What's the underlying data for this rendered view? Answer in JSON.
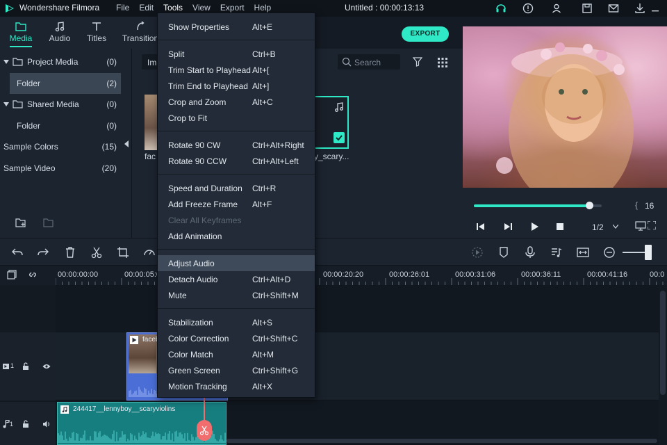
{
  "app": {
    "name": "Wondershare Filmora",
    "menus": [
      "File",
      "Edit",
      "Tools",
      "View",
      "Export",
      "Help"
    ],
    "active_menu": "Tools",
    "document_title": "Untitled : 00:00:13:13"
  },
  "media_tabs": [
    {
      "label": "Media",
      "icon": "media-folder-icon",
      "active": true
    },
    {
      "label": "Audio",
      "icon": "music-note-icon",
      "active": false
    },
    {
      "label": "Titles",
      "icon": "text-t-icon",
      "active": false
    },
    {
      "label": "Transition",
      "icon": "transition-icon",
      "active": false
    }
  ],
  "export_label": "EXPORT",
  "tree": [
    {
      "label": "Project Media",
      "count": "(0)",
      "folder": true
    },
    {
      "label": "Folder",
      "count": "(2)",
      "selected": true
    },
    {
      "label": "Shared Media",
      "count": "(0)",
      "folder": true
    },
    {
      "label": "Folder",
      "count": "(0)"
    },
    {
      "label": "Sample Colors",
      "count": "(15)"
    },
    {
      "label": "Sample Video",
      "count": "(20)"
    }
  ],
  "browser": {
    "import_label": "Im",
    "search_placeholder": "Search",
    "clip1_name": "fac",
    "clip2_name": "y_scary..."
  },
  "preview": {
    "progress": 0.9,
    "frame_value": "16",
    "quality": "1/2"
  },
  "ruler": [
    "00:00:00:00",
    "00:00:05:0",
    "00:00:20:20",
    "00:00:26:01",
    "00:00:31:06",
    "00:00:36:11",
    "00:00:41:16",
    "00:0"
  ],
  "tracks": {
    "video_clip_label": "faceb",
    "audio_clip_label": "244417__lennyboy__scaryviolins",
    "video_track_num": "1",
    "audio_track_num": "1"
  },
  "tools_menu": {
    "groups": [
      [
        {
          "label": "Show Properties",
          "shortcut": "Alt+E"
        }
      ],
      [
        {
          "label": "Split",
          "shortcut": "Ctrl+B"
        },
        {
          "label": "Trim Start to Playhead",
          "shortcut": "Alt+["
        },
        {
          "label": "Trim End to Playhead",
          "shortcut": "Alt+]"
        },
        {
          "label": "Crop and Zoom",
          "shortcut": "Alt+C"
        },
        {
          "label": "Crop to Fit",
          "shortcut": ""
        }
      ],
      [
        {
          "label": "Rotate 90 CW",
          "shortcut": "Ctrl+Alt+Right"
        },
        {
          "label": "Rotate 90 CCW",
          "shortcut": "Ctrl+Alt+Left"
        }
      ],
      [
        {
          "label": "Speed and Duration",
          "shortcut": "Ctrl+R"
        },
        {
          "label": "Add Freeze Frame",
          "shortcut": "Alt+F"
        },
        {
          "label": "Clear All Keyframes",
          "shortcut": "",
          "disabled": true
        },
        {
          "label": "Add Animation",
          "shortcut": ""
        }
      ],
      [
        {
          "label": "Adjust Audio",
          "shortcut": "",
          "highlighted": true
        },
        {
          "label": "Detach Audio",
          "shortcut": "Ctrl+Alt+D"
        },
        {
          "label": "Mute",
          "shortcut": "Ctrl+Shift+M"
        }
      ],
      [
        {
          "label": "Stabilization",
          "shortcut": "Alt+S"
        },
        {
          "label": "Color Correction",
          "shortcut": "Ctrl+Shift+C"
        },
        {
          "label": "Color Match",
          "shortcut": "Alt+M"
        },
        {
          "label": "Green Screen",
          "shortcut": "Ctrl+Shift+G"
        },
        {
          "label": "Motion Tracking",
          "shortcut": "Alt+X"
        }
      ]
    ]
  },
  "colors": {
    "accent": "#2ee8c6",
    "panel": "#1c2430",
    "menu_bg": "#222b37",
    "menu_highlight": "#3e4a59",
    "video_clip": "#4a6ed6",
    "audio_clip": "#1a8a8a",
    "playhead": "#f26d6d"
  }
}
